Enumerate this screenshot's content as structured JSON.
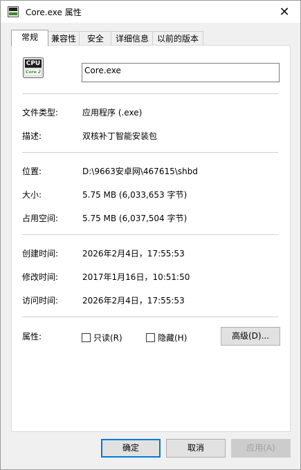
{
  "window": {
    "title": "Core.exe 属性",
    "close_glyph": "✕",
    "app_icon": {
      "name": "cpu-icon",
      "top_text": "CPU",
      "bottom_text": "Core 2",
      "accent": "#3a8a2a"
    }
  },
  "tabs": [
    "常规",
    "兼容性",
    "安全",
    "详细信息",
    "以前的版本"
  ],
  "general": {
    "file_name": "Core.exe",
    "rows_a": [
      {
        "label": "文件类型:",
        "value": "应用程序 (.exe)"
      },
      {
        "label": "描述:",
        "value": "双核补丁智能安装包"
      }
    ],
    "rows_b": [
      {
        "label": "位置:",
        "value": "D:\\9663安卓网\\467615\\shbd"
      },
      {
        "label": "大小:",
        "value": "5.75 MB (6,033,653 字节)"
      },
      {
        "label": "占用空间:",
        "value": "5.75 MB (6,037,504 字节)"
      }
    ],
    "rows_c": [
      {
        "label": "创建时间:",
        "value": "2026年2月4日，17:55:53"
      },
      {
        "label": "修改时间:",
        "value": "2017年1月16日，10:51:50"
      },
      {
        "label": "访问时间:",
        "value": "2026年2月4日，17:55:53"
      }
    ],
    "attributes": {
      "label": "属性:",
      "readonly_label": "只读(R)",
      "hidden_label": "隐藏(H)",
      "advanced_button": "高级(D)..."
    }
  },
  "buttons": {
    "ok": "确定",
    "cancel": "取消",
    "apply": "应用(A)"
  }
}
